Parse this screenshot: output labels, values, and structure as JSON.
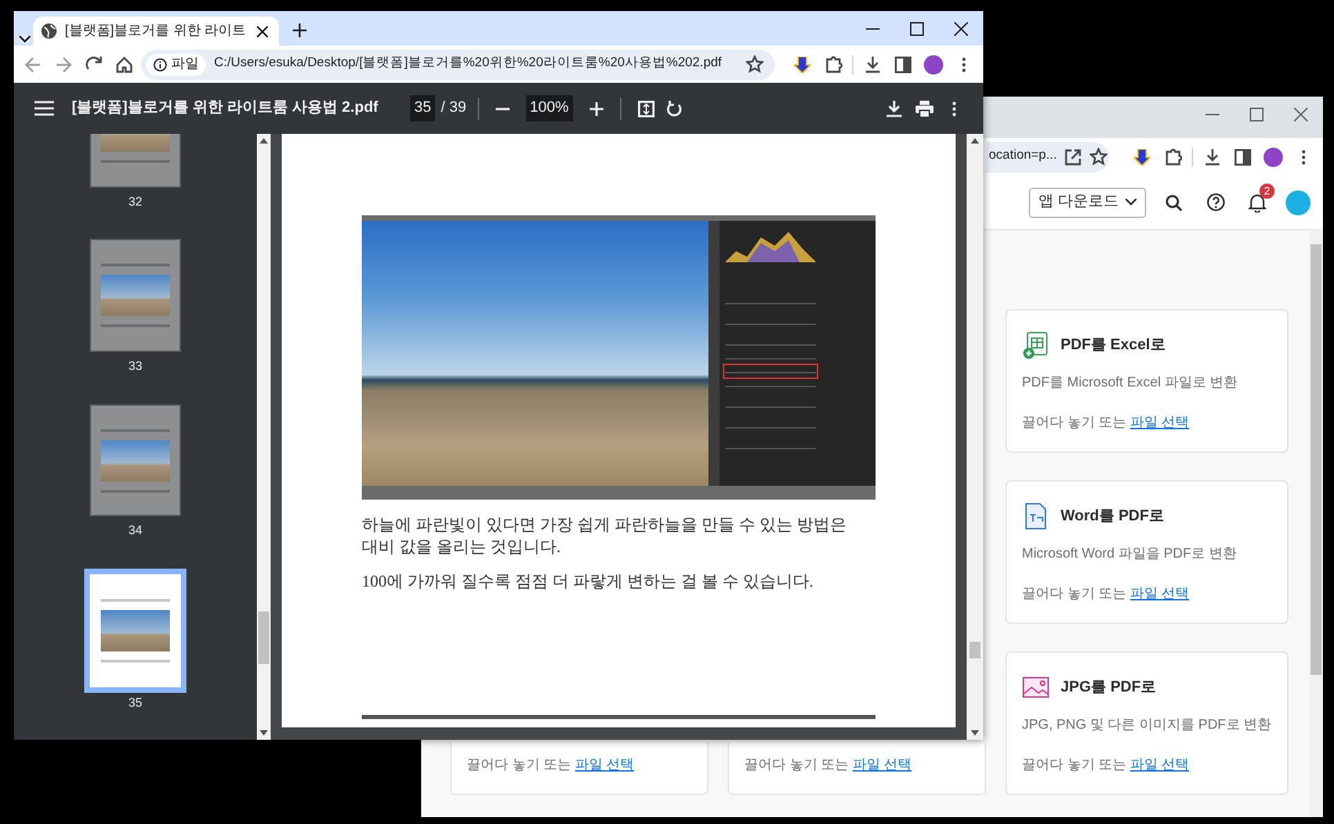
{
  "front_window": {
    "tab": {
      "title": "[블랫폼]블로거를 위한 라이트"
    },
    "address": {
      "chip": "파일",
      "url": "C:/Users/esuka/Desktop/[블랫폼]블로거를%20위한%20라이트룸%20사용법%202.pdf"
    },
    "pdf_toolbar": {
      "title": "[블랫폼]블로거를 위한 라이트룸 사용법 2.pdf",
      "page": "35",
      "page_total": "/ 39",
      "zoom": "100%"
    },
    "thumbnails": [
      {
        "label": "32",
        "selected": false
      },
      {
        "label": "33",
        "selected": false
      },
      {
        "label": "34",
        "selected": false
      },
      {
        "label": "35",
        "selected": true
      }
    ],
    "page": {
      "paragraphs": [
        "하늘에 파란빛이 있다면 가장 쉽게 파란하늘을 만들 수 있는 방법은 대비 값을 올리는 것입니다.",
        "100에 가까워 질수록 점점 더 파랗게 변하는 걸 볼 수 있습니다."
      ]
    }
  },
  "back_window": {
    "address_text": "ocation=p...",
    "app_download": "앱 다운로드",
    "notification_count": "2",
    "tools": [
      {
        "kind": "excel",
        "title": "PDF를 Excel로",
        "description": "PDF를 Microsoft Excel 파일로 변환",
        "drop_text": "끌어다 놓기 또는",
        "link": "파일 선택"
      },
      {
        "kind": "word",
        "title": "Word를 PDF로",
        "description": "Microsoft Word 파일을 PDF로 변환",
        "drop_text": "끌어다 놓기 또는",
        "link": "파일 선택"
      },
      {
        "kind": "jpg",
        "title": "JPG를 PDF로",
        "description": "JPG, PNG 및 다른 이미지를 PDF로 변환",
        "drop_text": "끌어다 놓기 또는",
        "link": "파일 선택"
      }
    ],
    "partial_tools": [
      {
        "drop_text": "끌어다 놓기 또는",
        "link": "파일 선택"
      },
      {
        "drop_text": "끌어다 놓기 또는",
        "link": "파일 선택"
      }
    ]
  }
}
